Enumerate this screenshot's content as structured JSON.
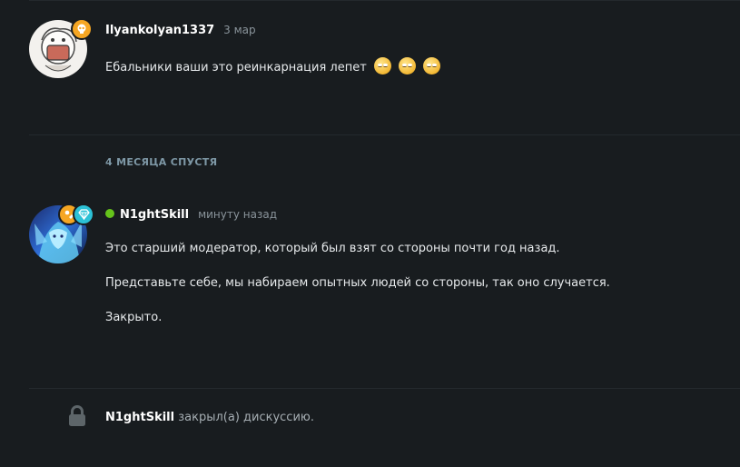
{
  "posts": [
    {
      "username": "Ilyankolyan1337",
      "time": "3 мар",
      "text": "Ебальники ваши это реинкарнация лепет",
      "emojis": [
        "eyeroll-emoji",
        "eyeroll-emoji",
        "eyeroll-emoji"
      ]
    },
    {
      "username": "N1ghtSkill",
      "time": "минуту назад",
      "online": true,
      "paragraphs": [
        "Это старший модератор, который был взят со стороны почти год назад.",
        "Представьте себе, мы набираем опытных людей со стороны, так оно случается.",
        "Закрыто."
      ]
    }
  ],
  "time_gap_label": "4 МЕСЯЦА СПУСТЯ",
  "event": {
    "username": "N1ghtSkill",
    "text": "закрыл(а) дискуссию.",
    "icon": "lock-icon"
  },
  "colors": {
    "background": "#181c1f",
    "online": "#65c31b",
    "badge_orange": "#f5a623",
    "badge_cyan": "#2cc1d6",
    "gap_label": "#7e98a6"
  }
}
